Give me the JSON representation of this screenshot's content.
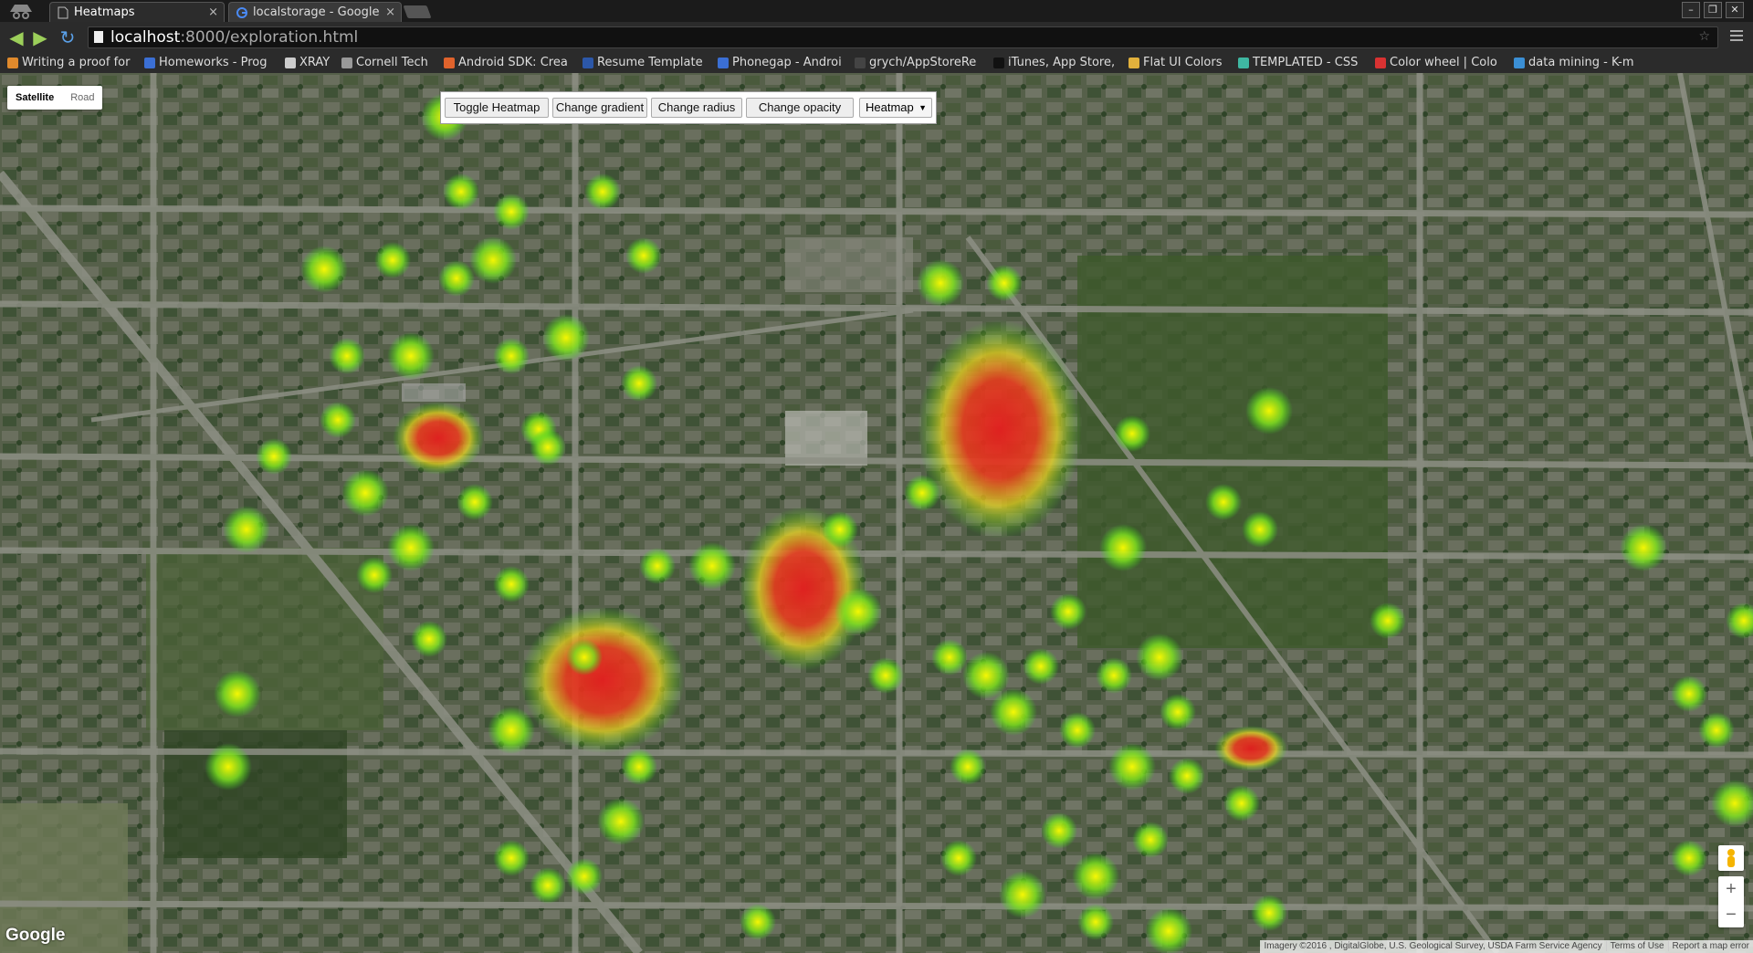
{
  "tabs": [
    {
      "title": "Heatmaps",
      "close": "×"
    },
    {
      "title": "localstorage - Google",
      "close": "×"
    }
  ],
  "window_controls": {
    "minimize": "–",
    "restore": "❐",
    "close": "✕"
  },
  "address_bar": {
    "host": "localhost",
    "path": ":8000/exploration.html"
  },
  "bookmarks": [
    {
      "label": "Writing a proof for",
      "color": "#e08a2c"
    },
    {
      "label": "Homeworks - Prog",
      "color": "#3b6fd4"
    },
    {
      "label": "XRAY",
      "color": "#cccccc"
    },
    {
      "label": "Cornell Tech",
      "color": "#999999"
    },
    {
      "label": "Android SDK: Crea",
      "color": "#e0632c"
    },
    {
      "label": "Resume Template",
      "color": "#2c57a8"
    },
    {
      "label": "Phonegap - Androi",
      "color": "#3b6fd4"
    },
    {
      "label": "grych/AppStoreRe",
      "color": "#444444"
    },
    {
      "label": "iTunes, App Store,",
      "color": "#111111"
    },
    {
      "label": "Flat UI Colors",
      "color": "#e2b13c"
    },
    {
      "label": "TEMPLATED - CSS",
      "color": "#3fb7a2"
    },
    {
      "label": "Color wheel | Colo",
      "color": "#d83232"
    },
    {
      "label": "data mining - K-m",
      "color": "#3b8fd4"
    }
  ],
  "map_type": {
    "satellite": "Satellite",
    "road": "Road"
  },
  "controls": {
    "toggle": "Toggle Heatmap",
    "gradient": "Change gradient",
    "radius": "Change radius",
    "opacity": "Change opacity",
    "layer_selected": "Heatmap"
  },
  "google_logo": "Google",
  "attribution": {
    "imagery": "Imagery ©2016 , DigitalGlobe, U.S. Geological Survey, USDA Farm Service Agency",
    "terms": "Terms of Use",
    "report": "Report a map error"
  },
  "zoom": {
    "in": "+",
    "out": "−"
  },
  "colors": {
    "heat_low": "#3cdc1e",
    "heat_mid": "#e6e61e",
    "heat_high": "#e61e1e"
  }
}
